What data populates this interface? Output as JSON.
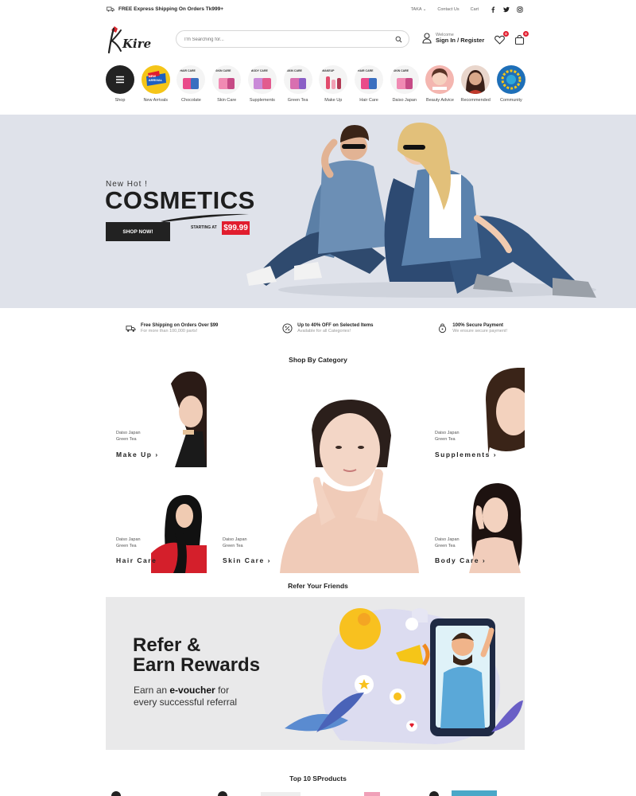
{
  "topbar": {
    "shipping_note": "FREE Express Shipping On Orders Tk999+",
    "currency": "TAKA",
    "contact": "Contact Us",
    "cart": "Cart",
    "social": [
      "facebook-icon",
      "twitter-icon",
      "instagram-icon"
    ]
  },
  "header": {
    "logo_text": "Kirei",
    "search_placeholder": "I'm Searching for...",
    "welcome": "Welcome",
    "signin": "Sign In / Register",
    "wishlist_count": "0",
    "cart_count": "0"
  },
  "categories": [
    {
      "label": "Shop",
      "tag": "",
      "color": "#222222"
    },
    {
      "label": "New Arrivals",
      "tag": "NEW ARRIVAL",
      "color": "#f5c518"
    },
    {
      "label": "Chocolate",
      "tag": "HAIR CARE",
      "color": "#e94b8a"
    },
    {
      "label": "Skin Care",
      "tag": "SKIN CARE",
      "color": "#f08ab3"
    },
    {
      "label": "Supplements",
      "tag": "BODY CARE",
      "color": "#c98ad8"
    },
    {
      "label": "Green Tea",
      "tag": "SKIN CARE",
      "color": "#d86fb0"
    },
    {
      "label": "Make Up",
      "tag": "MAKEUP",
      "color": "#e24b6c"
    },
    {
      "label": "Hair Care",
      "tag": "HAIR CARE",
      "color": "#e94b8a"
    },
    {
      "label": "Daiso Japan",
      "tag": "SKIN CARE",
      "color": "#f08ab3"
    },
    {
      "label": "Beauty Advice",
      "tag": "",
      "color": "#f4b6b0"
    },
    {
      "label": "Recommended",
      "tag": "",
      "color": "#7a4a3a"
    },
    {
      "label": "Community",
      "tag": "",
      "color": "#1e6fb8"
    }
  ],
  "hero": {
    "kicker": "New Hot !",
    "title": "COSMETICS",
    "button": "SHOP NOW!",
    "starting_at": "STARTING AT",
    "price": "$99.99",
    "accent": "#e11d2e"
  },
  "features": [
    {
      "icon": "truck-icon",
      "title": "Free Shipping on Orders Over $99",
      "sub": "For more than 100,000 parts!"
    },
    {
      "icon": "discount-icon",
      "title": "Up to 40% OFF on Selected Items",
      "sub": "Available for all Categories!"
    },
    {
      "icon": "lock-icon",
      "title": "100% Secure Payment",
      "sub": "We ensure secure payment!"
    }
  ],
  "shop_by_category": {
    "title": "Shop By Category",
    "tiles": [
      {
        "line1": "Daiso Japan",
        "line2": "Green Tea",
        "name": "Make Up"
      },
      {
        "line1": "Daiso Japan",
        "line2": "Green Tea",
        "name": "Supplements"
      },
      {
        "line1": "Daiso Japan",
        "line2": "Green Tea",
        "name": "Hair Care"
      },
      {
        "line1": "Daiso Japan",
        "line2": "Green Tea",
        "name": "Skin Care"
      },
      {
        "line1": "Daiso Japan",
        "line2": "Green Tea",
        "name": "Body Care"
      }
    ]
  },
  "refer": {
    "section_title": "Refer Your Friends",
    "line1": "Refer &",
    "line2": "Earn Rewards",
    "sub1": "Earn an ",
    "sub_bold": "e-voucher",
    "sub2": " for",
    "sub3": "every successful referral"
  },
  "top_products": {
    "title": "Top 10 SProducts"
  }
}
